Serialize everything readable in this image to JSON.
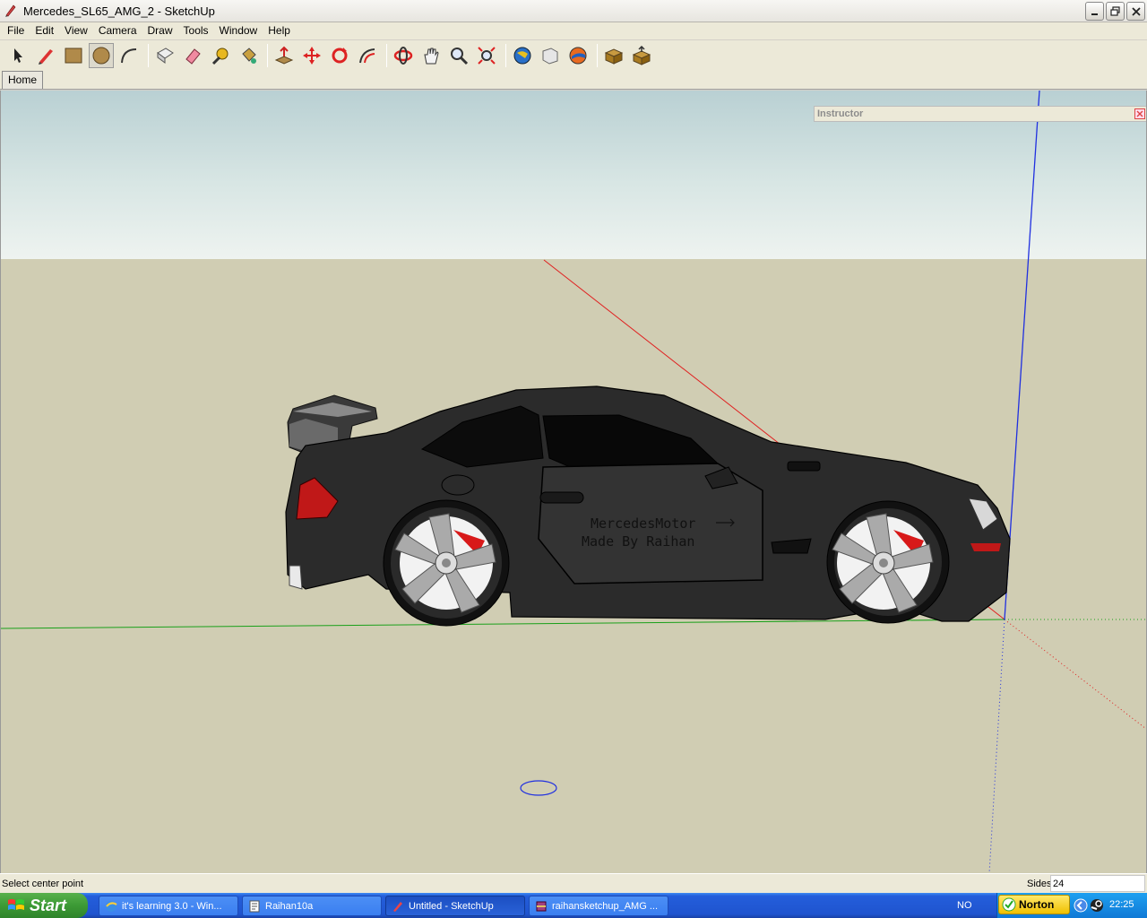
{
  "window": {
    "title": "Mercedes_SL65_AMG_2 - SketchUp"
  },
  "menu": [
    "File",
    "Edit",
    "View",
    "Camera",
    "Draw",
    "Tools",
    "Window",
    "Help"
  ],
  "toolbar": {
    "tools": [
      {
        "name": "select-tool",
        "icon": "arrow-icon"
      },
      {
        "name": "pencil-tool",
        "icon": "pencil-icon"
      },
      {
        "name": "rectangle-tool",
        "icon": "rectangle-icon"
      },
      {
        "name": "circle-tool",
        "icon": "circle-icon",
        "active": true
      },
      {
        "name": "arc-tool",
        "icon": "arc-icon"
      },
      {
        "name": "make-component-tool",
        "icon": "component-icon"
      },
      {
        "name": "eraser-tool",
        "icon": "eraser-icon"
      },
      {
        "name": "tape-measure-tool",
        "icon": "tape-icon"
      },
      {
        "name": "paint-bucket-tool",
        "icon": "bucket-icon"
      },
      {
        "name": "push-pull-tool",
        "icon": "pushpull-icon"
      },
      {
        "name": "move-tool",
        "icon": "move-icon"
      },
      {
        "name": "rotate-tool",
        "icon": "rotate-icon"
      },
      {
        "name": "offset-tool",
        "icon": "offset-icon"
      },
      {
        "name": "orbit-tool",
        "icon": "orbit-icon"
      },
      {
        "name": "pan-tool",
        "icon": "hand-icon"
      },
      {
        "name": "zoom-tool",
        "icon": "magnifier-icon"
      },
      {
        "name": "zoom-extents-tool",
        "icon": "zoom-extents-icon"
      },
      {
        "name": "get-models-tool",
        "icon": "globe-icon"
      },
      {
        "name": "share-model-tool",
        "icon": "share-icon"
      },
      {
        "name": "google-earth-tool",
        "icon": "earth-icon"
      },
      {
        "name": "get-components-tool",
        "icon": "box-icon"
      },
      {
        "name": "share-component-tool",
        "icon": "box-share-icon"
      }
    ]
  },
  "scenes": {
    "home_tab": "Home"
  },
  "instructor": {
    "title": "Instructor"
  },
  "model": {
    "decal_line1": "MercedesMotor",
    "decal_line2": "Made By Raihan",
    "car_color": "#2b2b2b",
    "caliper_color": "#d81919"
  },
  "axes": {
    "red": "#e02020",
    "green": "#1aa01a",
    "blue": "#2030e0"
  },
  "status": {
    "text": "Select center point",
    "vcb_label": "Sides",
    "vcb_value": "24"
  },
  "taskbar": {
    "start": "Start",
    "tasks": [
      {
        "label": "it's learning 3.0 - Win...",
        "icon": "ie-icon"
      },
      {
        "label": "Raihan10a",
        "icon": "document-icon"
      },
      {
        "label": "Untitled - SketchUp",
        "icon": "sketchup-icon",
        "active": true
      },
      {
        "label": "raihansketchup_AMG ...",
        "icon": "winrar-icon"
      }
    ],
    "language": "NO",
    "norton": "Norton",
    "clock": "22:25"
  }
}
